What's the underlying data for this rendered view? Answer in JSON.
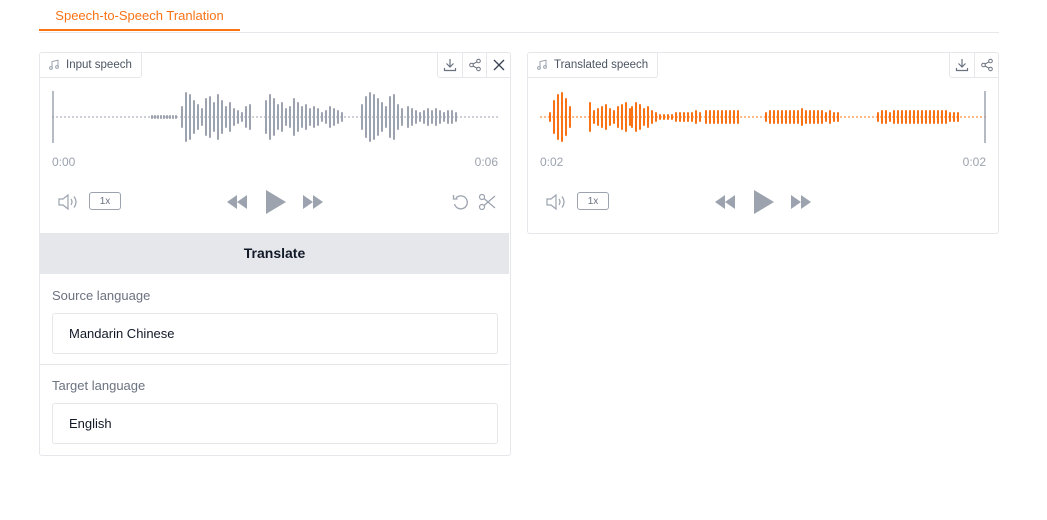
{
  "tabs": [
    {
      "label": "Speech-to-Speech Tranlation",
      "active": true
    }
  ],
  "input_panel": {
    "label": "Input speech",
    "time_start": "0:00",
    "time_end": "0:06",
    "speed": "1x",
    "wave_color": "#9ca3af",
    "icons": [
      "music-note-icon",
      "download-icon",
      "share-icon",
      "close-icon",
      "volume-icon",
      "rewind-icon",
      "play-icon",
      "fast-forward-icon",
      "undo-icon",
      "scissors-icon"
    ]
  },
  "translate_button": {
    "label": "Translate"
  },
  "source_language": {
    "label": "Source language",
    "value": "Mandarin Chinese"
  },
  "target_language": {
    "label": "Target language",
    "value": "English"
  },
  "output_panel": {
    "label": "Translated speech",
    "time_start": "0:02",
    "time_end": "0:02",
    "speed": "1x",
    "wave_color": "#f97316",
    "icons": [
      "music-note-icon",
      "download-icon",
      "share-icon",
      "volume-icon",
      "rewind-icon",
      "play-icon",
      "fast-forward-icon"
    ]
  },
  "colors": {
    "accent": "#f97316",
    "border": "#e5e7eb",
    "button_bg": "#e5e7eb"
  }
}
